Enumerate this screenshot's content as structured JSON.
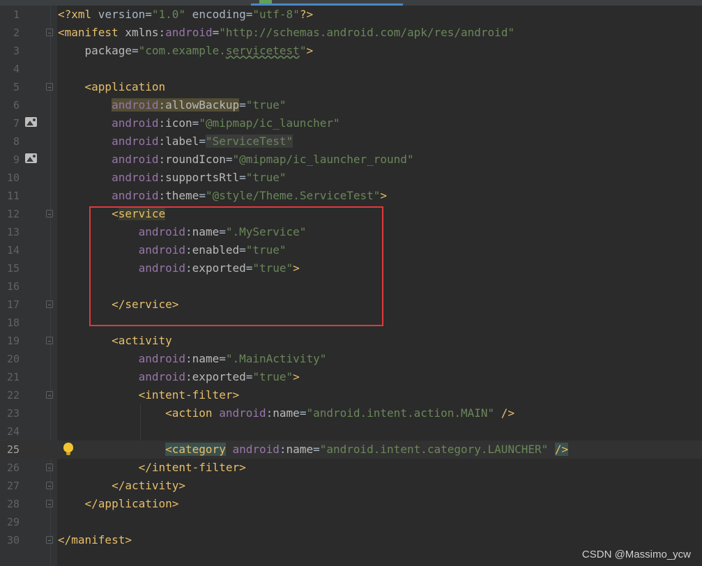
{
  "line_numbers": [
    "1",
    "2",
    "3",
    "4",
    "5",
    "6",
    "7",
    "8",
    "9",
    "10",
    "11",
    "12",
    "13",
    "14",
    "15",
    "16",
    "17",
    "18",
    "19",
    "20",
    "21",
    "22",
    "23",
    "24",
    "25",
    "26",
    "27",
    "28",
    "29",
    "30"
  ],
  "code": {
    "l1": {
      "decl_open": "<?xml",
      "version_attr": " version",
      "eq": "=",
      "version_val": "\"1.0\"",
      "encoding_attr": " encoding",
      "encoding_val": "\"utf-8\"",
      "decl_close": "?>"
    },
    "l2": {
      "tag": "<manifest",
      "space": " ",
      "xmlns": "xmlns",
      "colon": ":",
      "ns": "android",
      "eq": "=",
      "val": "\"http://schemas.android.com/apk/res/android\""
    },
    "l3": {
      "attr": "package",
      "eq": "=",
      "val_a": "\"com.example.",
      "val_b": "servicetest",
      "val_c": "\"",
      "close": ">"
    },
    "l5": {
      "tag": "<application"
    },
    "l6": {
      "ns": "android",
      "colon": ":",
      "attr": "allowBackup",
      "eq": "=",
      "val": "\"true\""
    },
    "l7": {
      "ns": "android",
      "colon": ":",
      "attr": "icon",
      "eq": "=",
      "val": "\"@mipmap/ic_launcher\""
    },
    "l8": {
      "ns": "android",
      "colon": ":",
      "attr": "label",
      "eq": "=",
      "val": "\"ServiceTest\""
    },
    "l9": {
      "ns": "android",
      "colon": ":",
      "attr": "roundIcon",
      "eq": "=",
      "val": "\"@mipmap/ic_launcher_round\""
    },
    "l10": {
      "ns": "android",
      "colon": ":",
      "attr": "supportsRtl",
      "eq": "=",
      "val": "\"true\""
    },
    "l11": {
      "ns": "android",
      "colon": ":",
      "attr": "theme",
      "eq": "=",
      "val": "\"@style/Theme.ServiceTest\"",
      "close": ">"
    },
    "l12": {
      "lt": "<",
      "tag": "service"
    },
    "l13": {
      "ns": "android",
      "colon": ":",
      "attr": "name",
      "eq": "=",
      "val": "\".MyService\""
    },
    "l14": {
      "ns": "android",
      "colon": ":",
      "attr": "enabled",
      "eq": "=",
      "val": "\"true\""
    },
    "l15": {
      "ns": "android",
      "colon": ":",
      "attr": "exported",
      "eq": "=",
      "val": "\"true\"",
      "close": ">"
    },
    "l17": {
      "tag": "</service>"
    },
    "l19": {
      "tag": "<activity"
    },
    "l20": {
      "ns": "android",
      "colon": ":",
      "attr": "name",
      "eq": "=",
      "val": "\".MainActivity\""
    },
    "l21": {
      "ns": "android",
      "colon": ":",
      "attr": "exported",
      "eq": "=",
      "val": "\"true\"",
      "close": ">"
    },
    "l22": {
      "tag": "<intent-filter>"
    },
    "l23": {
      "tag": "<action",
      "space": " ",
      "ns": "android",
      "colon": ":",
      "attr": "name",
      "eq": "=",
      "val": "\"android.intent.action.MAIN\"",
      "close": " />"
    },
    "l25": {
      "tag": "<category",
      "space": " ",
      "ns": "android",
      "colon": ":",
      "attr": "name",
      "eq": "=",
      "val": "\"android.intent.category.LAUNCHER\"",
      "sp2": " ",
      "close": "/>"
    },
    "l26": {
      "tag": "</intent-filter>"
    },
    "l27": {
      "tag": "</activity>"
    },
    "l28": {
      "tag": "</application>"
    },
    "l30": {
      "tag": "</manifest>"
    }
  },
  "watermark": "CSDN @Massimo_ycw",
  "colors": {
    "background": "#2b2b2b",
    "tag": "#e8bf6a",
    "namespace": "#9876aa",
    "value": "#6a8759",
    "highlight_box": "#e0393e"
  },
  "icons": {
    "gutter_image": "image-icon",
    "intention": "lightbulb-icon",
    "fold": "fold-marker-icon"
  }
}
